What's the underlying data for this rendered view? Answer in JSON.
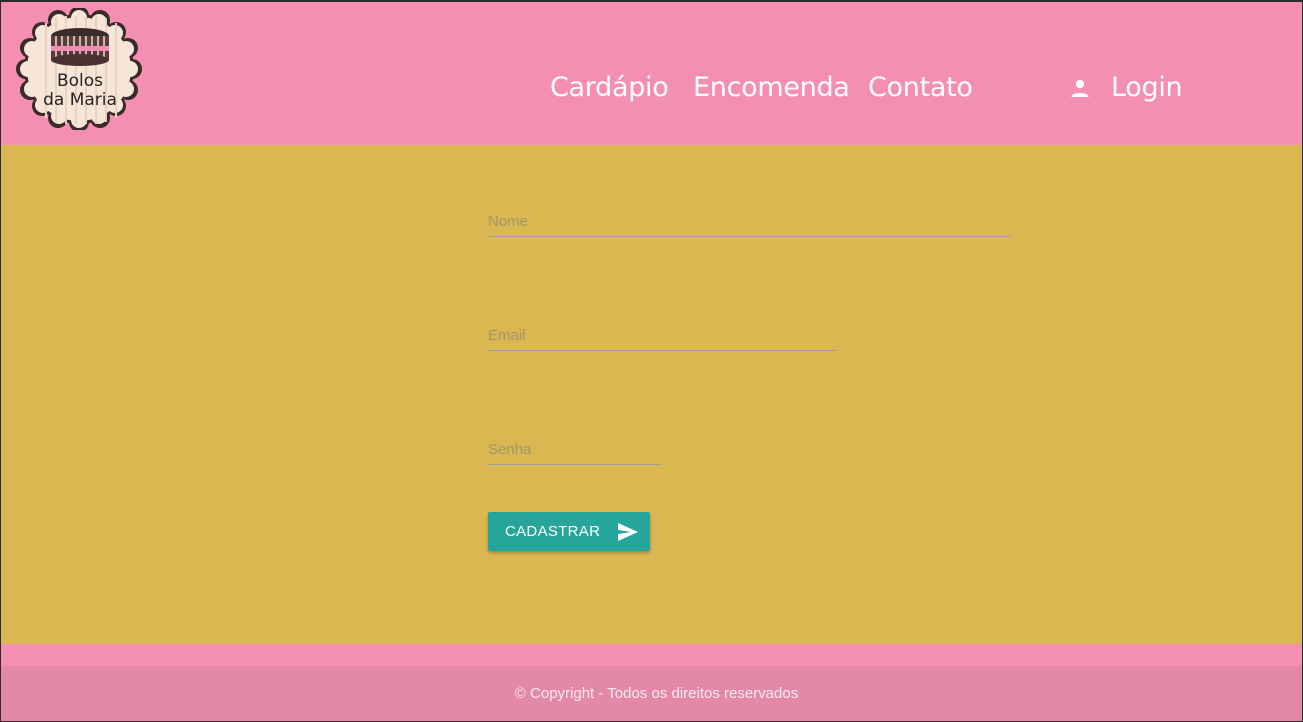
{
  "brand": {
    "logo_line1": "Bolos",
    "logo_line2": "da Maria",
    "icon": "cake-logo"
  },
  "nav": {
    "items": [
      {
        "label": "Cardápio"
      },
      {
        "label": "Encomenda"
      },
      {
        "label": "Contato"
      }
    ],
    "login": {
      "label": "Login",
      "icon": "person-icon"
    }
  },
  "form": {
    "name_placeholder": "Nome",
    "email_placeholder": "Email",
    "password_placeholder": "Senha",
    "name_value": "",
    "email_value": "",
    "password_value": "",
    "submit_label": "CADASTRAR",
    "submit_icon": "send-icon"
  },
  "footer": {
    "copyright": "© Copyright - Todos os direitos reservados"
  },
  "colors": {
    "header": "#f48fb1",
    "main": "#dab751",
    "button": "#26a69a",
    "footer": "#e388a6"
  }
}
